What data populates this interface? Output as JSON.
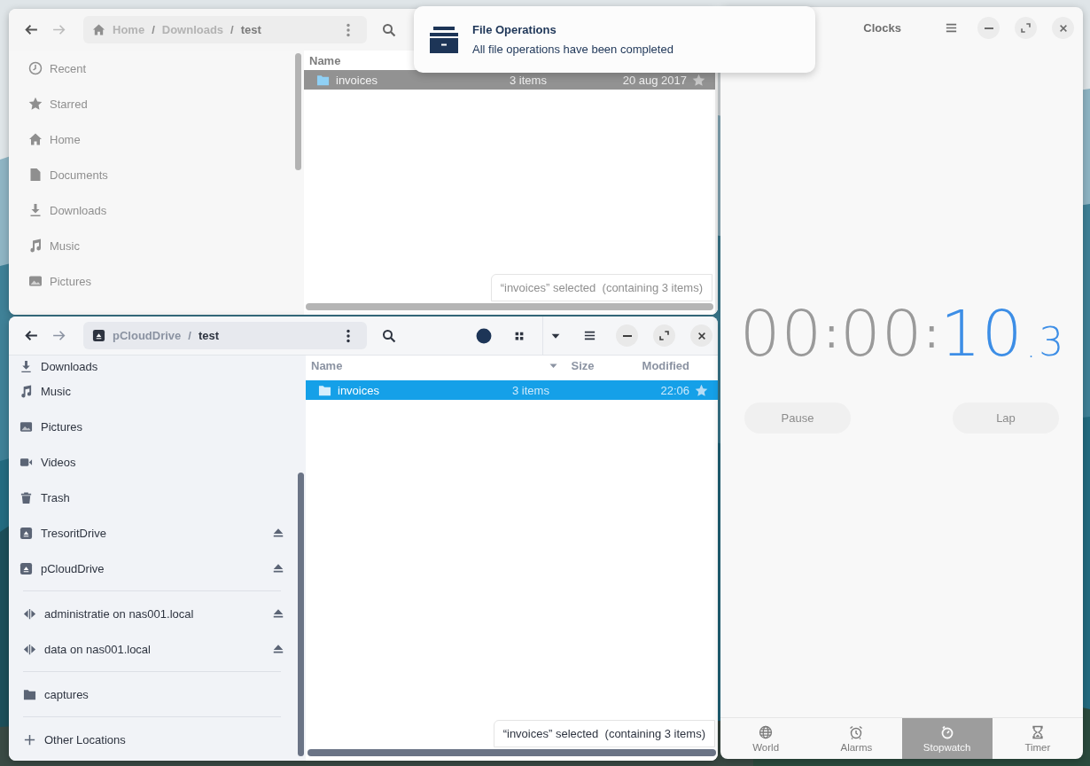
{
  "files_back": {
    "path": [
      {
        "kind": "home",
        "label": "Home"
      },
      {
        "kind": "sep",
        "label": "/"
      },
      {
        "kind": "dir",
        "label": "Downloads"
      },
      {
        "kind": "sep",
        "label": "/"
      },
      {
        "kind": "current",
        "label": "test"
      }
    ],
    "sidebar": [
      {
        "kind": "recent",
        "label": "Recent"
      },
      {
        "kind": "star",
        "label": "Starred"
      },
      {
        "kind": "home",
        "label": "Home"
      },
      {
        "kind": "document",
        "label": "Documents"
      },
      {
        "kind": "download",
        "label": "Downloads"
      },
      {
        "kind": "music",
        "label": "Music"
      },
      {
        "kind": "picture",
        "label": "Pictures"
      }
    ],
    "columns": [
      "Name"
    ],
    "rows": [
      {
        "name": "invoices",
        "size": "3 items",
        "modified": "20 aug 2017",
        "selected": true
      }
    ],
    "status": "“invoices” selected  (containing 3 items)"
  },
  "files_front": {
    "path": [
      {
        "kind": "drive",
        "label": "pCloudDrive"
      },
      {
        "kind": "sep",
        "label": "/"
      },
      {
        "kind": "current",
        "label": "test"
      }
    ],
    "sidebar": [
      [
        {
          "kind": "download",
          "label": "Downloads",
          "ejectable": false
        },
        {
          "kind": "music",
          "label": "Music",
          "ejectable": false
        },
        {
          "kind": "picture",
          "label": "Pictures",
          "ejectable": false
        },
        {
          "kind": "video",
          "label": "Videos",
          "ejectable": false
        },
        {
          "kind": "trash",
          "label": "Trash",
          "ejectable": false
        },
        {
          "kind": "drive",
          "label": "TresoritDrive",
          "ejectable": true
        },
        {
          "kind": "drive",
          "label": "pCloudDrive",
          "ejectable": true
        }
      ],
      [
        {
          "kind": "network",
          "label": "administratie on nas001.local",
          "ejectable": true
        },
        {
          "kind": "network",
          "label": "data on nas001.local",
          "ejectable": true
        }
      ],
      [
        {
          "kind": "folder",
          "label": "captures",
          "ejectable": false
        }
      ],
      [
        {
          "kind": "plus",
          "label": "Other Locations",
          "ejectable": false
        }
      ]
    ],
    "columns": [
      "Name",
      "Size",
      "Modified"
    ],
    "rows": [
      {
        "name": "invoices",
        "size": "3 items",
        "modified": "22:06",
        "selected": true
      }
    ],
    "status": "“invoices” selected  (containing 3 items)"
  },
  "notification": {
    "title": "File Operations",
    "body": "All file operations have been completed"
  },
  "clocks": {
    "title": "Clocks",
    "display": [
      {
        "kind": "digits",
        "text": "00",
        "active": false
      },
      {
        "kind": "colon",
        "text": ":",
        "active": false
      },
      {
        "kind": "digits",
        "text": "00",
        "active": false
      },
      {
        "kind": "colon",
        "text": ":",
        "active": false
      },
      {
        "kind": "digits",
        "text": "10",
        "active": true
      },
      {
        "kind": "dot",
        "text": ".",
        "active": true
      },
      {
        "kind": "small",
        "text": "3",
        "active": true
      }
    ],
    "buttons": [
      "Pause",
      "Lap"
    ],
    "tabs": [
      {
        "kind": "globe",
        "label": "World",
        "selected": false
      },
      {
        "kind": "alarm",
        "label": "Alarms",
        "selected": false
      },
      {
        "kind": "stopwatch",
        "label": "Stopwatch",
        "selected": true
      },
      {
        "kind": "hourglass",
        "label": "Timer",
        "selected": false
      }
    ]
  }
}
